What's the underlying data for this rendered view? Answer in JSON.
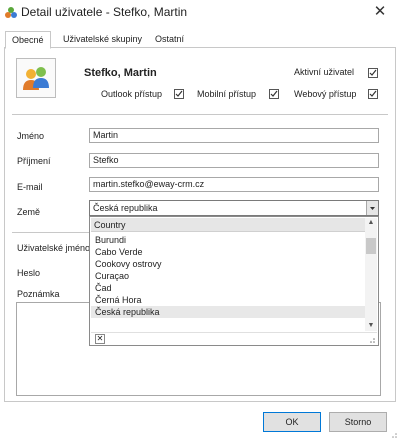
{
  "window": {
    "title": "Detail uživatele - Stefko, Martin",
    "close_icon": "close-icon"
  },
  "tabs": [
    {
      "label": "Obecné",
      "active": true
    },
    {
      "label": "Uživatelské skupiny",
      "active": false
    },
    {
      "label": "Ostatní",
      "active": false
    }
  ],
  "user": {
    "display_name": "Stefko, Martin",
    "active_label": "Aktivní uživatel",
    "active_checked": true,
    "outlook_label": "Outlook přístup",
    "outlook_checked": true,
    "mobile_label": "Mobilní přístup",
    "mobile_checked": true,
    "web_label": "Webový přístup",
    "web_checked": true
  },
  "form": {
    "first_name_label": "Jméno",
    "first_name_value": "Martin",
    "last_name_label": "Příjmení",
    "last_name_value": "Stefko",
    "email_label": "E-mail",
    "email_value": "martin.stefko@eway-crm.cz",
    "country_label": "Země",
    "country_value": "Česká republika",
    "username_label": "Uživatelské jméno",
    "password_label": "Heslo",
    "note_label": "Poznámka"
  },
  "country_dropdown": {
    "header": "Country",
    "options": [
      "Burundi",
      "Cabo Verde",
      "Cookovy ostrovy",
      "Curaçao",
      "Čad",
      "Černá Hora",
      "Česká republika"
    ],
    "selected": "Česká republika"
  },
  "buttons": {
    "ok": "OK",
    "cancel": "Storno"
  },
  "colors": {
    "accent": "#0078d7",
    "dropdown_header": "#e6e6e6"
  }
}
